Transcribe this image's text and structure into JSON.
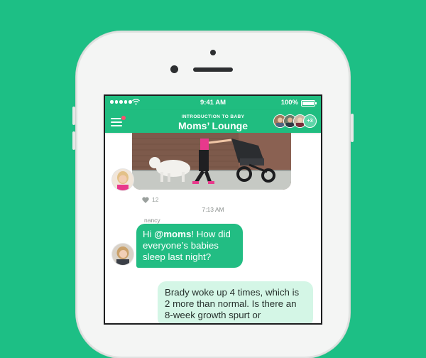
{
  "status_bar": {
    "time": "9:41 AM",
    "battery": "100%",
    "wifi_icon": "wifi-icon"
  },
  "header": {
    "subtitle": "INTRODUCTION TO BABY",
    "title": "Moms’ Lounge",
    "members_more": "+3",
    "menu_icon": "hamburger-menu-icon"
  },
  "messages": [
    {
      "type": "photo",
      "photo_description_icon": "woman-walking-dog-with-stroller-photo",
      "likes": "12",
      "like_icon": "heart-icon"
    },
    {
      "type": "timestamp",
      "text": "7:13 AM"
    },
    {
      "type": "incoming",
      "sender": "nancy",
      "text_before": "Hi ",
      "mention": "@moms",
      "text_after": "! How did everyone’s babies sleep last night?"
    },
    {
      "type": "outgoing",
      "text": "Brady woke up 4 times, which is 2 more than normal. Is there an 8-week growth spurt or"
    }
  ],
  "colors": {
    "brand_green": "#20bd80",
    "outgoing_bubble": "#d4f6e6",
    "incoming_bubble": "#22bd83"
  }
}
